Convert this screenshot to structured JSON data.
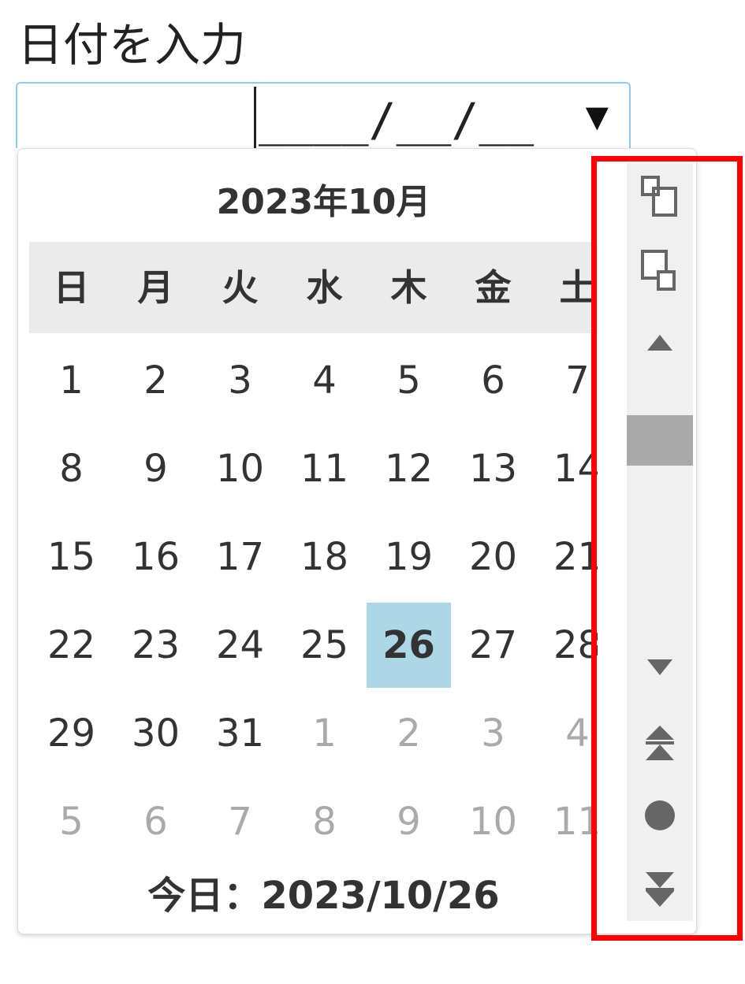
{
  "field": {
    "label": "日付を入力",
    "input_mask": "____/__/__",
    "dropdown_glyph": "▼"
  },
  "calendar": {
    "month_title": "2023年10月",
    "weekdays": [
      "日",
      "月",
      "火",
      "水",
      "木",
      "金",
      "土"
    ],
    "weeks": [
      [
        {
          "d": "1"
        },
        {
          "d": "2"
        },
        {
          "d": "3"
        },
        {
          "d": "4"
        },
        {
          "d": "5"
        },
        {
          "d": "6"
        },
        {
          "d": "7"
        }
      ],
      [
        {
          "d": "8"
        },
        {
          "d": "9"
        },
        {
          "d": "10"
        },
        {
          "d": "11"
        },
        {
          "d": "12"
        },
        {
          "d": "13"
        },
        {
          "d": "14"
        }
      ],
      [
        {
          "d": "15"
        },
        {
          "d": "16"
        },
        {
          "d": "17"
        },
        {
          "d": "18"
        },
        {
          "d": "19"
        },
        {
          "d": "20"
        },
        {
          "d": "21"
        }
      ],
      [
        {
          "d": "22"
        },
        {
          "d": "23"
        },
        {
          "d": "24"
        },
        {
          "d": "25"
        },
        {
          "d": "26",
          "selected": true
        },
        {
          "d": "27"
        },
        {
          "d": "28"
        }
      ],
      [
        {
          "d": "29"
        },
        {
          "d": "30"
        },
        {
          "d": "31"
        },
        {
          "d": "1",
          "other": true
        },
        {
          "d": "2",
          "other": true
        },
        {
          "d": "3",
          "other": true
        },
        {
          "d": "4",
          "other": true
        }
      ],
      [
        {
          "d": "5",
          "other": true
        },
        {
          "d": "6",
          "other": true
        },
        {
          "d": "7",
          "other": true
        },
        {
          "d": "8",
          "other": true
        },
        {
          "d": "9",
          "other": true
        },
        {
          "d": "10",
          "other": true
        },
        {
          "d": "11",
          "other": true
        }
      ]
    ],
    "today_label": "今日：2023/10/26",
    "selected_color": "#acd7e6"
  },
  "toolbar": {
    "buttons": [
      "copy-front-icon",
      "copy-back-icon",
      "arrow-up-icon",
      "arrow-down-icon",
      "double-arrow-up-icon",
      "circle-icon",
      "double-arrow-down-icon"
    ]
  },
  "colors": {
    "highlight": "#ff0000",
    "input_border": "#8ecbf0"
  }
}
